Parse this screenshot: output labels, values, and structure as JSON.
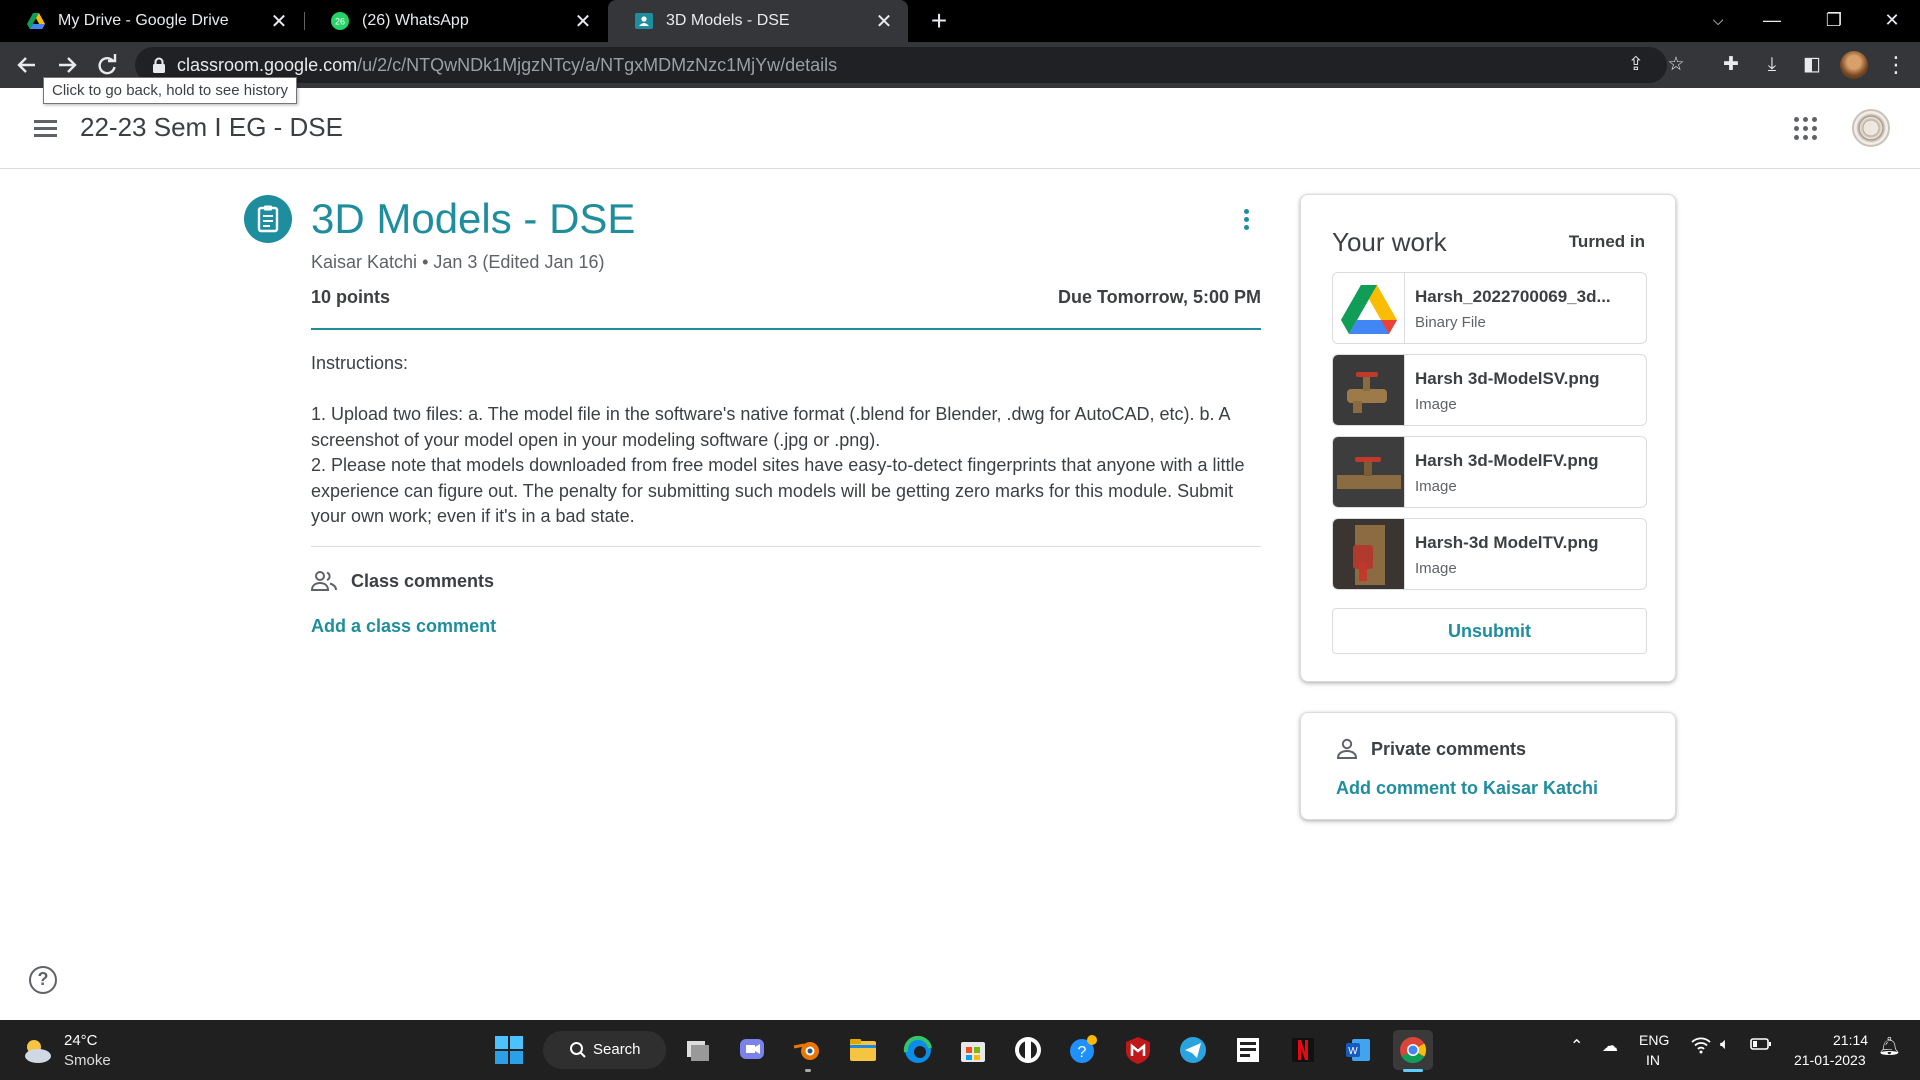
{
  "browser": {
    "tabs": [
      {
        "title": "My Drive - Google Drive",
        "active": false
      },
      {
        "title": "(26) WhatsApp",
        "active": false,
        "badge": "26"
      },
      {
        "title": "3D Models - DSE",
        "active": true
      }
    ],
    "url_host": "classroom.google.com",
    "url_path": "/u/2/c/NTQwNDk1MjgzNTcy/a/NTgxMDMzNzc1MjYw/details",
    "tooltip": "Click to go back, hold to see history"
  },
  "header": {
    "class_title": "22-23 Sem I EG - DSE"
  },
  "assignment": {
    "title": "3D Models - DSE",
    "author": "Kaisar Katchi",
    "meta_separator": " • ",
    "date": "Jan 3 (Edited Jan 16)",
    "points": "10 points",
    "due": "Due Tomorrow, 5:00 PM",
    "instructions": "Instructions:\n\n1. Upload two files: a. The model file in the software's native format (.blend for Blender, .dwg for AutoCAD, etc). b. A screenshot of your model open in your modeling software (.jpg or .png).\n2. Please note that models downloaded from free model sites have easy-to-detect fingerprints that anyone with a little experience can figure out. The penalty for submitting such models will be getting zero marks for this module. Submit your own work; even if it's in a bad state."
  },
  "comments": {
    "heading": "Class comments",
    "add_label": "Add a class comment"
  },
  "your_work": {
    "title": "Your work",
    "status": "Turned in",
    "attachments": [
      {
        "name": "Harsh_2022700069_3d...",
        "type": "Binary File",
        "thumb": "google-drive-icon"
      },
      {
        "name": "Harsh 3d-ModelSV.png",
        "type": "Image",
        "thumb": "faucet-side-view"
      },
      {
        "name": "Harsh 3d-ModelFV.png",
        "type": "Image",
        "thumb": "faucet-front-view"
      },
      {
        "name": "Harsh-3d ModelTV.png",
        "type": "Image",
        "thumb": "faucet-top-view"
      }
    ],
    "unsubmit_label": "Unsubmit"
  },
  "private_comments": {
    "heading": "Private comments",
    "add_label": "Add comment to Kaisar Katchi"
  },
  "taskbar": {
    "weather_temp": "24°C",
    "weather_desc": "Smoke",
    "search_label": "Search",
    "lang_top": "ENG",
    "lang_bottom": "IN",
    "time": "21:14",
    "date": "21-01-2023"
  },
  "colors": {
    "accent": "#1e8e9e",
    "chrome_dark": "#35363a",
    "taskbar": "#202020"
  }
}
